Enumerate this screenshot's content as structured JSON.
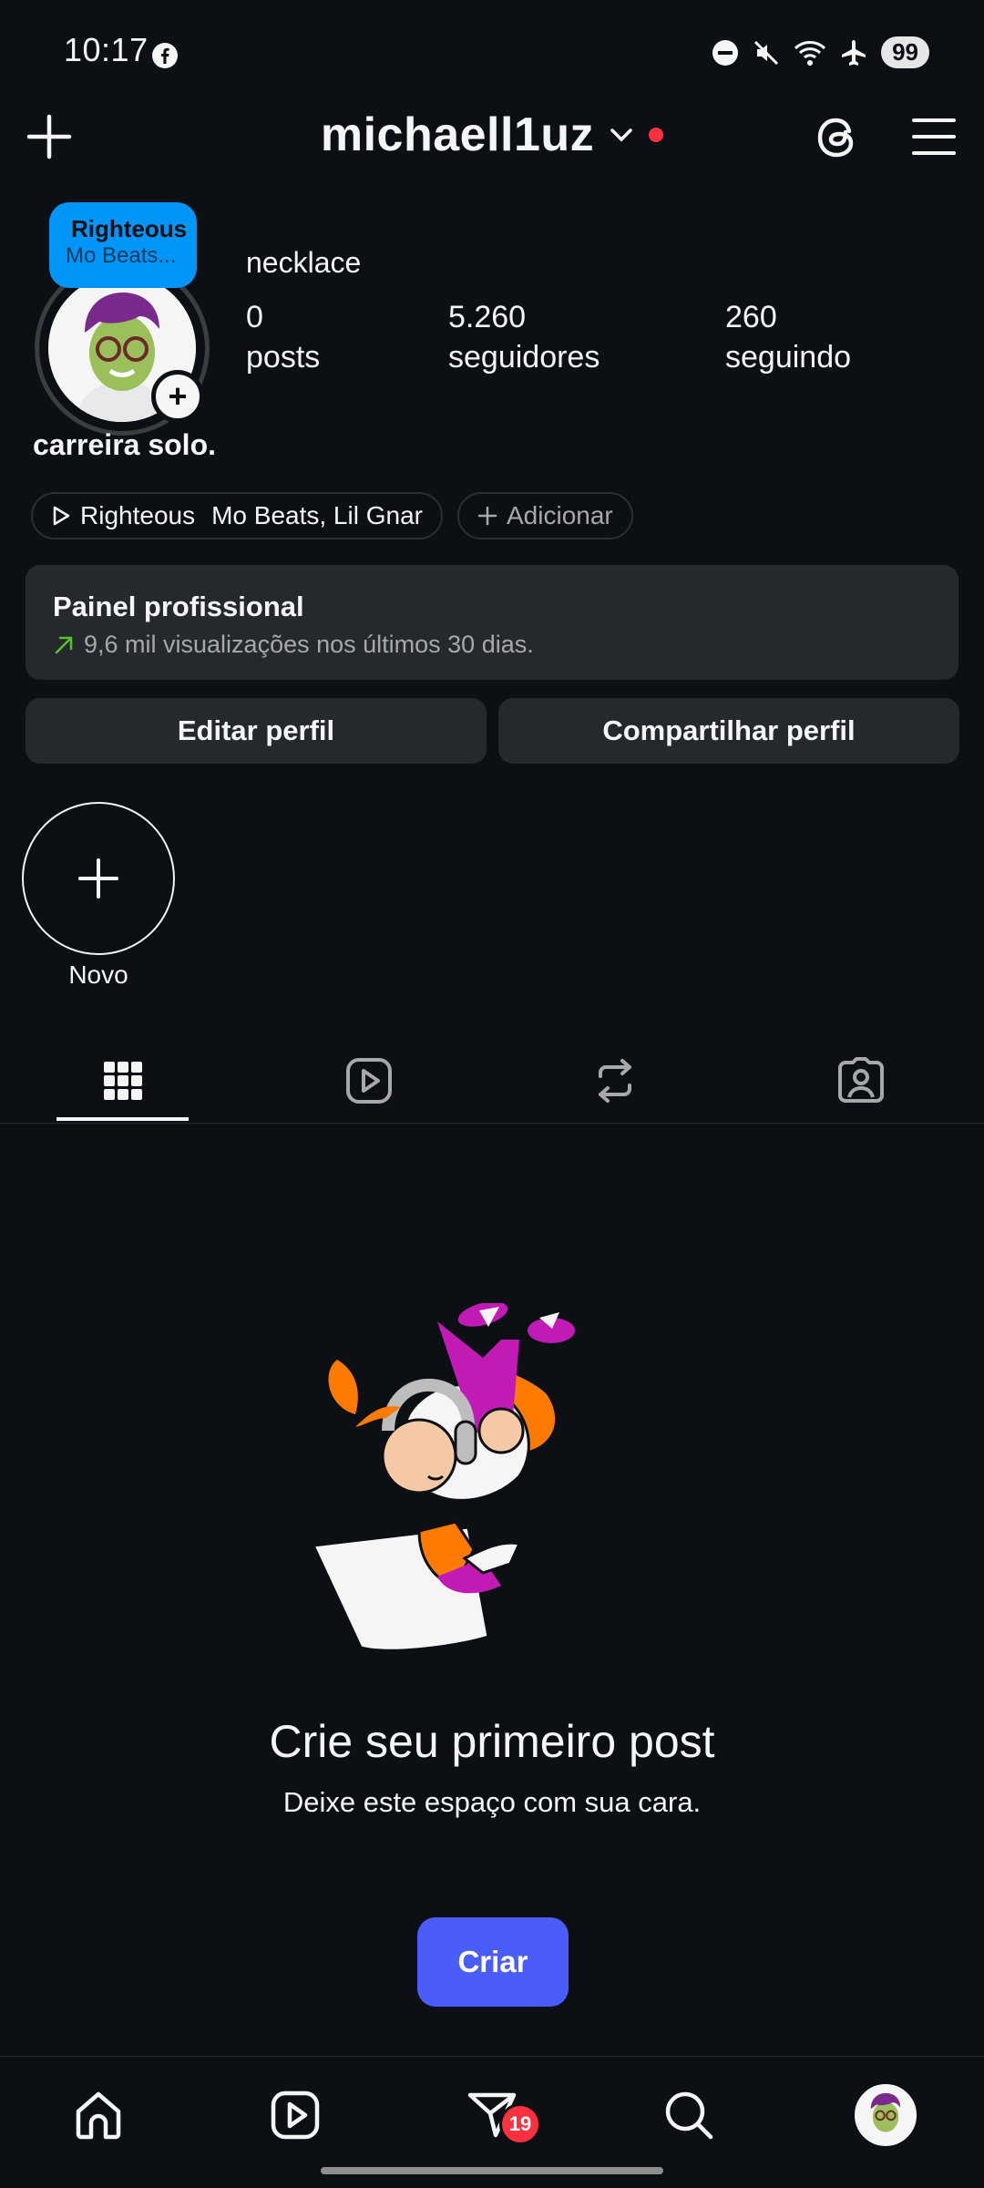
{
  "status_bar": {
    "time": "10:17",
    "battery": "99",
    "icons": [
      "facebook-icon",
      "do-not-disturb-icon",
      "mute-icon",
      "wifi-icon",
      "airplane-icon"
    ]
  },
  "header": {
    "username": "michaell1uz",
    "icons": [
      "plus-icon",
      "chevron-down-icon",
      "threads-icon",
      "hamburger-menu-icon"
    ]
  },
  "profile": {
    "note": {
      "title": "Righteous",
      "subtitle": "Mo Beats..."
    },
    "category": "necklace",
    "display_name": "carreira solo.",
    "stats": [
      {
        "value": "0",
        "label": "posts"
      },
      {
        "value": "5.260",
        "label": "seguidores"
      },
      {
        "value": "260",
        "label": "seguindo"
      }
    ],
    "music_chip": {
      "title": "Righteous",
      "artists": "Mo Beats, Lil Gnar"
    },
    "add_chip": "Adicionar"
  },
  "dashboard": {
    "title": "Painel profissional",
    "subtitle": "9,6 mil visualizações nos últimos 30 dias."
  },
  "buttons": {
    "edit": "Editar perfil",
    "share": "Compartilhar perfil"
  },
  "highlights": {
    "new_label": "Novo"
  },
  "tabs": [
    "grid-icon",
    "reels-icon",
    "reposts-icon",
    "tagged-icon"
  ],
  "empty_state": {
    "title": "Crie seu primeiro post",
    "subtitle": "Deixe este espaço com sua cara.",
    "button": "Criar"
  },
  "bottom_nav": {
    "items": [
      "home-icon",
      "reels-icon",
      "messages-icon",
      "search-icon",
      "profile-avatar"
    ],
    "messages_badge": "19"
  },
  "colors": {
    "background": "#0c1014",
    "surface": "#25292e",
    "primary_button": "#4a5df9",
    "note_blue": "#0095f6",
    "notification_red": "#ff3040",
    "trend_green": "#58c322"
  }
}
